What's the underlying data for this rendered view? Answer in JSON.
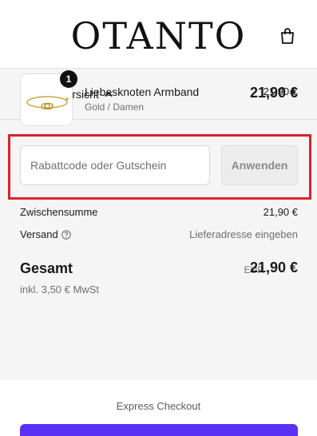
{
  "header": {
    "logo": "OTANTO",
    "cart_icon": "shopping-bag-icon"
  },
  "summary": {
    "toggle_label": "Bestellübersicht",
    "toggle_icon": "chevron-up-icon",
    "total": "21,90 €"
  },
  "product": {
    "quantity": "1",
    "name": "Liebesknoten Armband",
    "variant": "Gold / Damen",
    "price": "21,90 €",
    "image_icon": "bracelet-icon"
  },
  "discount": {
    "placeholder": "Rabattcode oder Gutschein",
    "value": "",
    "apply_label": "Anwenden"
  },
  "totals": {
    "subtotal_label": "Zwischensumme",
    "subtotal_value": "21,90 €",
    "shipping_label": "Versand",
    "shipping_value": "Lieferadresse eingeben",
    "shipping_help_icon": "help-circle-icon",
    "total_label": "Gesamt",
    "total_currency": "EUR",
    "total_value": "21,90 €",
    "tax_note": "inkl. 3,50 € MwSt"
  },
  "express": {
    "label": "Express Checkout",
    "button_color": "#5a31f4"
  },
  "colors": {
    "highlight": "#d9232d",
    "summary_bg": "#f5f5f5"
  }
}
